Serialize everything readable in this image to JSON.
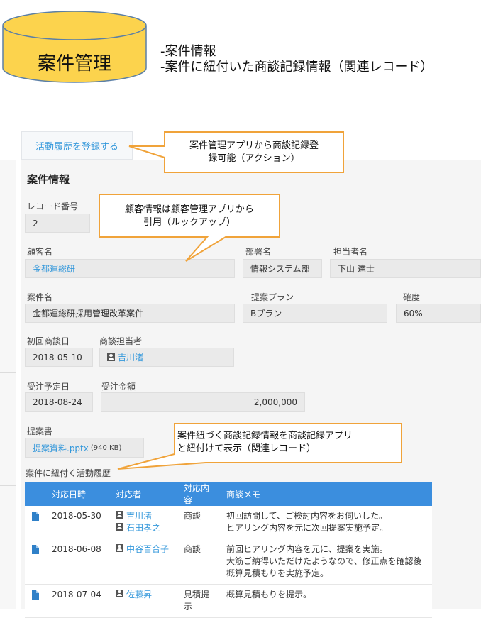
{
  "diagram": {
    "cylinder_label": "案件管理",
    "desc_lines": [
      "-案件情報",
      "-案件に紐付いた商談記録情報（関連レコード）"
    ]
  },
  "action_button": "活動履歴を登録する",
  "callouts": {
    "action": [
      "案件管理アプリから商談記録登",
      "録可能（アクション）"
    ],
    "lookup": [
      "顧客情報は顧客管理アプリから",
      "引用（ルックアップ）"
    ],
    "related": [
      "案件紐づく商談記録情報を商談記録アプリ",
      "と紐付けて表示（関連レコード）"
    ]
  },
  "record": {
    "section_title": "案件情報",
    "record_no_label": "レコード番号",
    "record_no": "2",
    "customer_label": "顧客名",
    "customer": "金都運総研",
    "dept_label": "部署名",
    "dept": "情報システム部",
    "owner_label": "担当者名",
    "owner": "下山 達士",
    "case_label": "案件名",
    "case": "金都運総研採用管理改革案件",
    "plan_label": "提案プラン",
    "plan": "Bプラン",
    "prob_label": "確度",
    "prob": "60%",
    "first_date_label": "初回商談日",
    "first_date": "2018-05-10",
    "rep_label": "商談担当者",
    "rep": "吉川渚",
    "order_date_label": "受注予定日",
    "order_date": "2018-08-24",
    "amount_label": "受注金額",
    "amount": "2,000,000",
    "proposal_label": "提案書",
    "proposal_file": "提案資料.pptx",
    "proposal_size": "(940 KB)",
    "related_label": "案件に紐付く活動履歴"
  },
  "related_table": {
    "headers": [
      "対応日時",
      "対応者",
      "対応内容",
      "商談メモ"
    ],
    "rows": [
      {
        "date": "2018-05-30",
        "persons": [
          "吉川渚",
          "石田孝之"
        ],
        "type": "商談",
        "memo": [
          "初回訪問して、ご検討内容をお伺いした。",
          "ヒアリング内容を元に次回提案実施予定。"
        ]
      },
      {
        "date": "2018-06-08",
        "persons": [
          "中谷百合子"
        ],
        "type": "商談",
        "memo": [
          "前回ヒアリング内容を元に、提案を実施。",
          "大筋ご納得いただけたようなので、修正点を確認後",
          "概算見積もりを実施予定。"
        ]
      },
      {
        "date": "2018-07-04",
        "persons": [
          "佐藤昇"
        ],
        "type": "見積提示",
        "memo": [
          "概算見積もりを提示。"
        ]
      }
    ]
  },
  "colors": {
    "cylinder_fill": "#fcd34d",
    "cylinder_stroke": "#5b7fa6",
    "accent": "#3498db",
    "table_header": "#3b8ede",
    "callout_stroke": "#f0a33a"
  }
}
